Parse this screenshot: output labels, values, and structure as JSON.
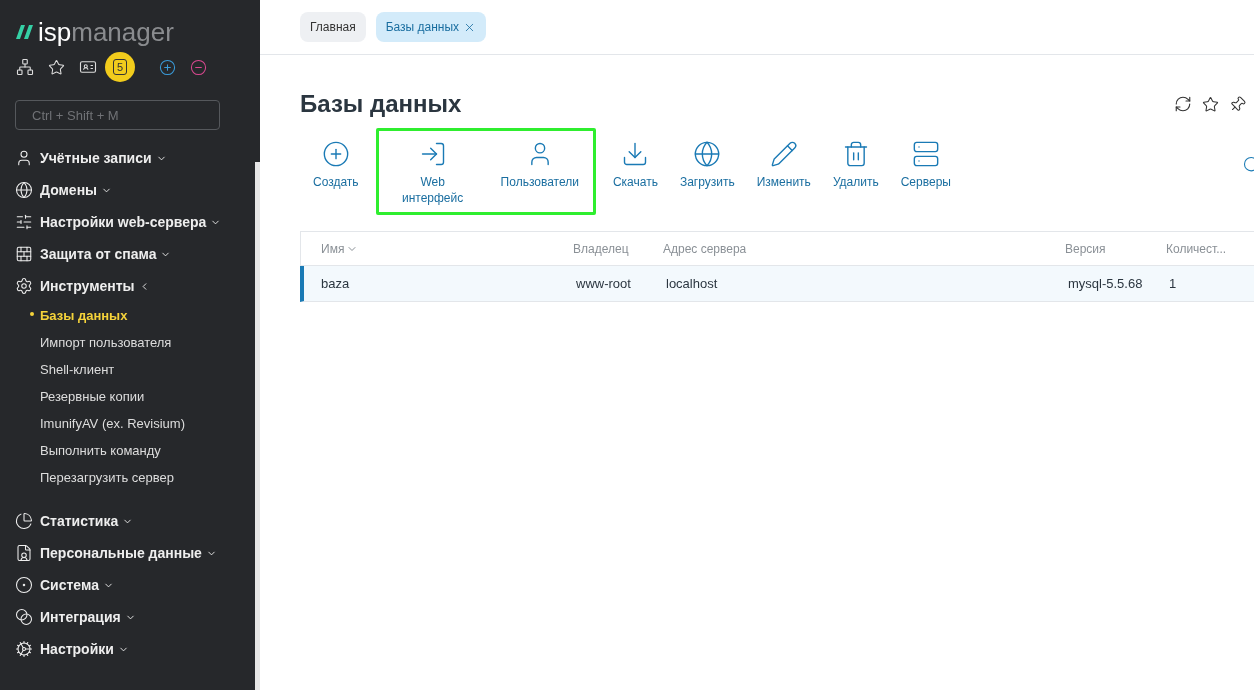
{
  "logo": {
    "bold": "isp",
    "light": "manager"
  },
  "quick_bar": {
    "badge": "5"
  },
  "search": {
    "placeholder": "Ctrl + Shift + M"
  },
  "nav": [
    {
      "label": "Учётные записи",
      "expanded": false
    },
    {
      "label": "Домены",
      "expanded": false
    },
    {
      "label": "Настройки web-сервера",
      "expanded": false
    },
    {
      "label": "Защита от спама",
      "expanded": false
    },
    {
      "label": "Инструменты",
      "expanded": true,
      "children": [
        {
          "label": "Базы данных",
          "selected": true
        },
        {
          "label": "Импорт пользователя",
          "selected": false
        },
        {
          "label": "Shell-клиент",
          "selected": false
        },
        {
          "label": "Резервные копии",
          "selected": false
        },
        {
          "label": "ImunifyAV (ex. Revisium)",
          "selected": false
        },
        {
          "label": "Выполнить команду",
          "selected": false
        },
        {
          "label": "Перезагрузить сервер",
          "selected": false
        }
      ]
    },
    {
      "label": "Статистика",
      "expanded": false
    },
    {
      "label": "Персональные данные",
      "expanded": false
    },
    {
      "label": "Система",
      "expanded": false
    },
    {
      "label": "Интеграция",
      "expanded": false
    },
    {
      "label": "Настройки",
      "expanded": false
    }
  ],
  "tabs": [
    {
      "label": "Главная",
      "selected": false,
      "closable": false
    },
    {
      "label": "Базы данных",
      "selected": true,
      "closable": true
    }
  ],
  "page_title": "Базы данных",
  "action_groups": [
    {
      "highlighted": false,
      "actions": [
        {
          "label": "Создать"
        }
      ]
    },
    {
      "highlighted": true,
      "actions": [
        {
          "label": "Web интерфейс"
        },
        {
          "label": "Пользователи"
        }
      ]
    },
    {
      "highlighted": false,
      "actions": [
        {
          "label": "Скачать"
        },
        {
          "label": "Загрузить"
        },
        {
          "label": "Изменить"
        },
        {
          "label": "Удалить"
        },
        {
          "label": "Серверы"
        }
      ]
    }
  ],
  "table": {
    "columns": [
      {
        "label": "Имя",
        "sorted": true
      },
      {
        "label": "Владелец",
        "sorted": false
      },
      {
        "label": "Адрес сервера",
        "sorted": false
      },
      {
        "label": "Версия",
        "sorted": false
      },
      {
        "label": "Количест...",
        "sorted": false
      }
    ],
    "rows": [
      {
        "cells": [
          "baza",
          "www-root",
          "localhost",
          "mysql-5.5.68",
          "1"
        ],
        "selected": true
      }
    ]
  }
}
